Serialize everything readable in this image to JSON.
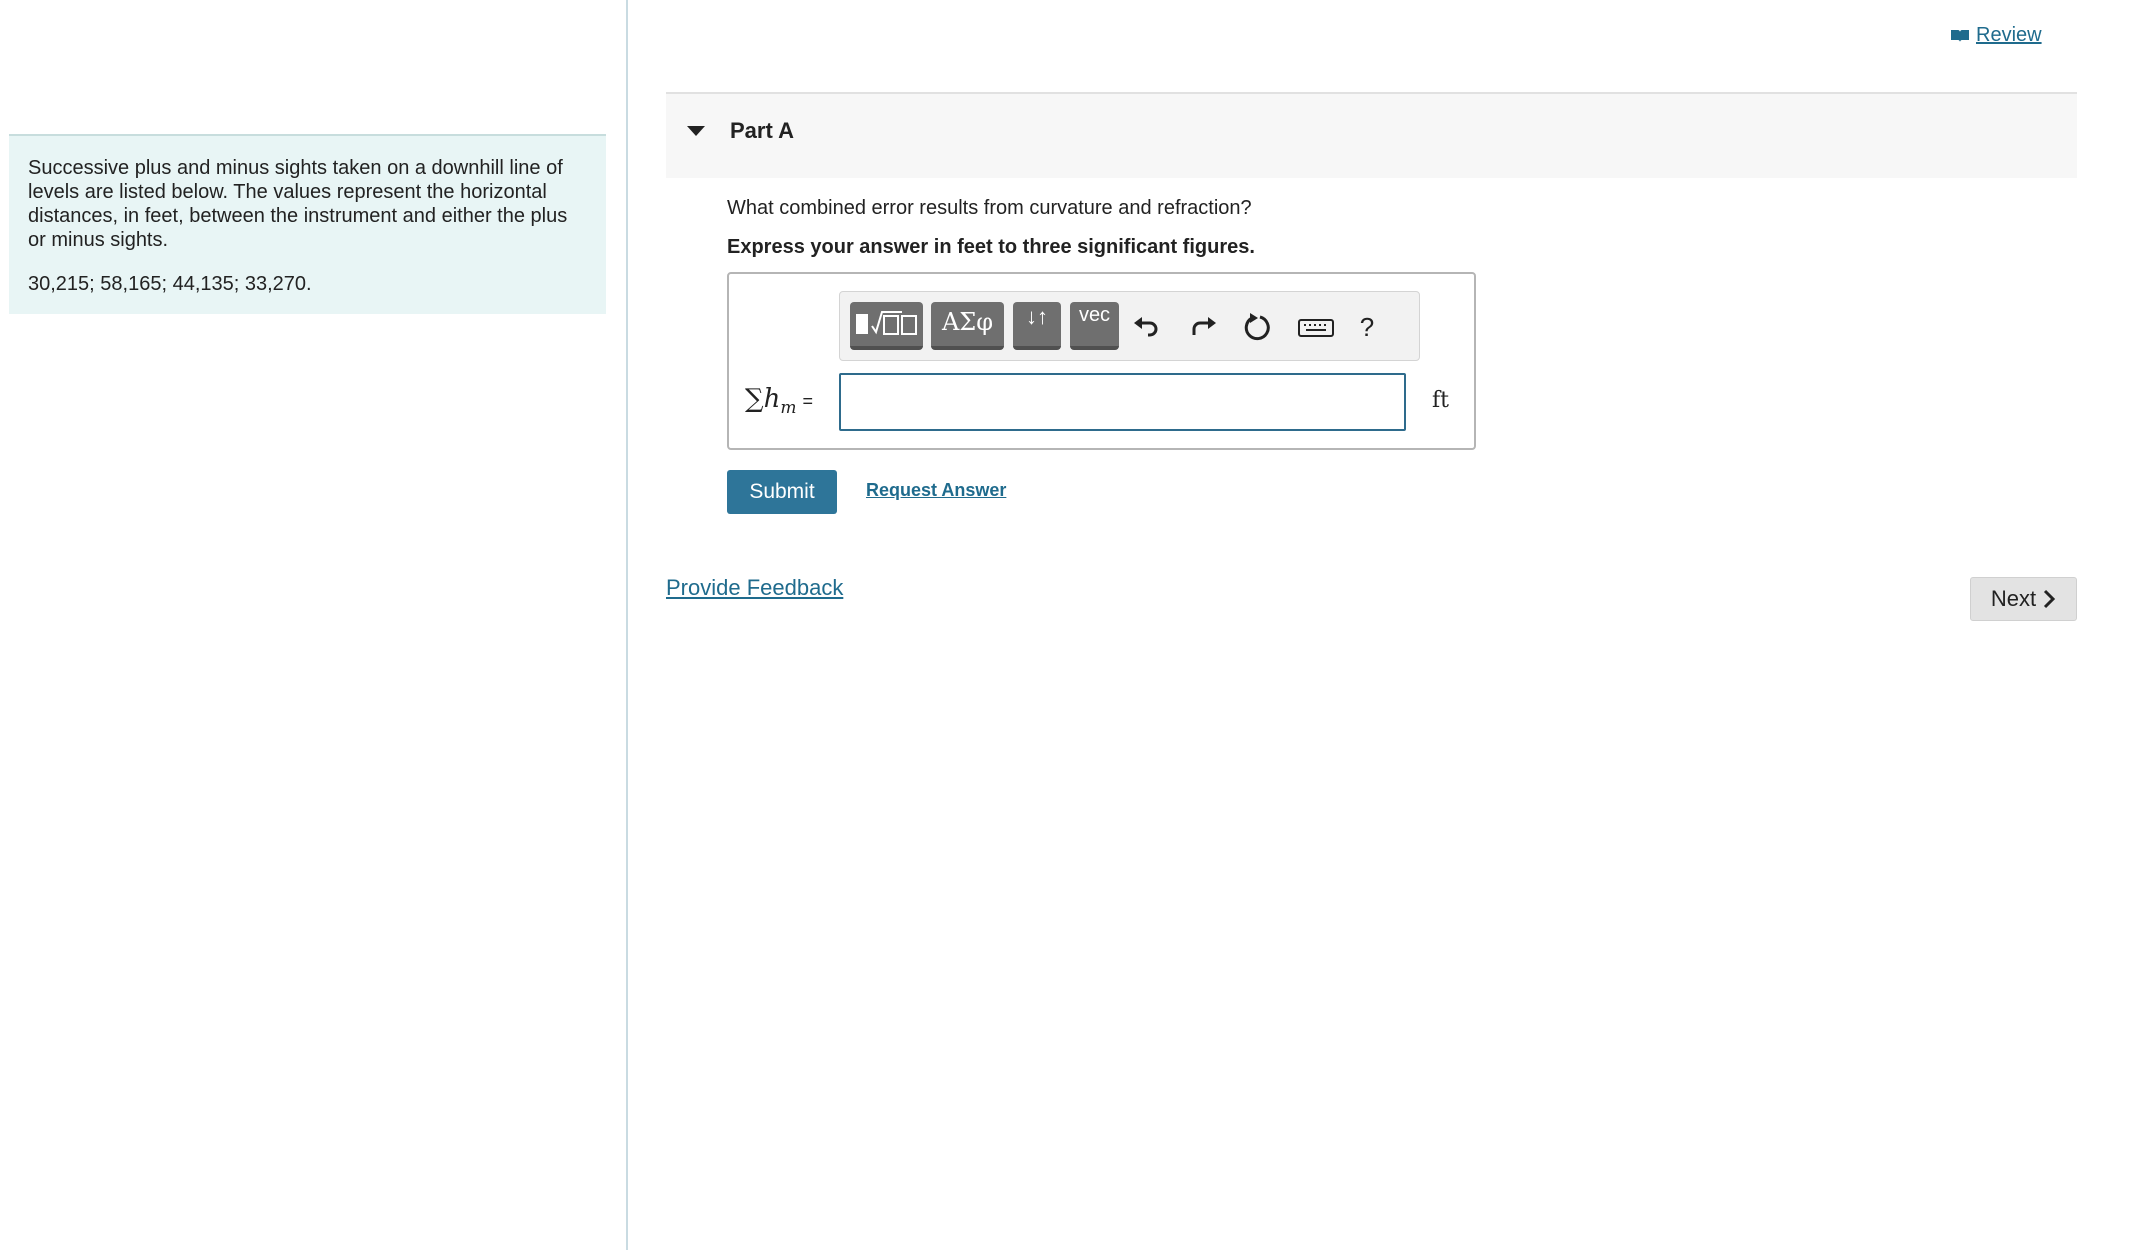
{
  "header": {
    "review_label": " Review"
  },
  "info_panel": {
    "description": "Successive plus and minus sights taken on a downhill line of levels are listed below. The values represent the horizontal distances, in feet, between the instrument and either the plus or minus sights.",
    "values": "30,215; 58,165; 44,135; 33,270."
  },
  "part": {
    "title": "Part A",
    "question": "What combined error results from curvature and refraction?",
    "instruction": "Express your answer in feet to three significant figures."
  },
  "toolbar": {
    "greek_label": "ΑΣφ",
    "arrows_label": "↓↑",
    "vec_label": "vec",
    "help_label": "?",
    "icons": [
      "templates-icon",
      "undo-icon",
      "redo-icon",
      "reset-icon",
      "keyboard-icon",
      "help-icon"
    ]
  },
  "answer": {
    "label_symbol": "∑",
    "label_var": "h",
    "label_sub": "m",
    "label_eq": "=",
    "value": "",
    "unit": "ft"
  },
  "actions": {
    "submit_label": "Submit",
    "request_answer_label": "Request Answer",
    "feedback_label": "Provide Feedback",
    "next_label": "Next"
  },
  "colors": {
    "accent": "#2e7599",
    "link": "#1f6b8d",
    "info_bg": "#e8f5f5"
  }
}
